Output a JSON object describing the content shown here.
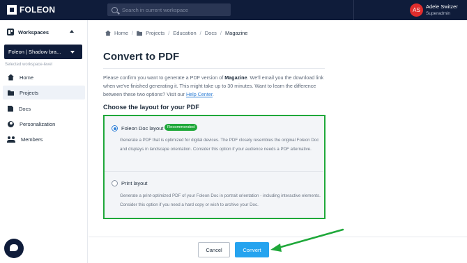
{
  "app": {
    "logo_text": "FOLEON",
    "search_placeholder": "Search in current workspace",
    "user": {
      "initials": "AS",
      "name": "Adele Switzer",
      "role": "Superadmin"
    }
  },
  "sidebar": {
    "workspaces_label": "Workspaces",
    "selected_workspace": "Foleon | Shadow bra...",
    "workspace_level": "Selected workspace-level",
    "items": [
      {
        "label": "Home",
        "icon": "home-icon",
        "active": false
      },
      {
        "label": "Projects",
        "icon": "folder-icon",
        "active": true
      },
      {
        "label": "Docs",
        "icon": "doc-icon",
        "active": false
      },
      {
        "label": "Personalization",
        "icon": "person-icon",
        "active": false
      },
      {
        "label": "Members",
        "icon": "members-icon",
        "active": false
      }
    ]
  },
  "breadcrumb": [
    "Home",
    "Projects",
    "Education",
    "Docs",
    "Magazine"
  ],
  "main": {
    "title": "Convert to PDF",
    "desc_pre": "Please confirm you want to generate a PDF version of ",
    "desc_doc": "Magazine",
    "desc_post": ". We'll email you the download link when we've finished generating it. This might take up to 30 minutes. Want to learn the difference between these two options? Visit our ",
    "help_link": "Help Center",
    "desc_end": ".",
    "layout_heading": "Choose the layout for your PDF",
    "options": [
      {
        "label": "Foleon Doc layout",
        "badge": "Recommended",
        "checked": true,
        "description": "Generate a PDF that is optimized for digital devices. The PDF closely resembles the original Foleon Doc and displays in landscape orientation. Consider this option if your audience needs a PDF alternative."
      },
      {
        "label": "Print layout",
        "checked": false,
        "description": "Generate a print-optimized PDF of your Foleon Doc in portrait orientation - including interactive elements. Consider this option if you need a hard copy or wish to archive your Doc."
      }
    ]
  },
  "footer": {
    "cancel_label": "Cancel",
    "convert_label": "Convert"
  },
  "colors": {
    "navy": "#0f1c3a",
    "accent_blue": "#25a3ef",
    "highlight_green": "#1fa83a",
    "avatar_red": "#e02d2d"
  }
}
